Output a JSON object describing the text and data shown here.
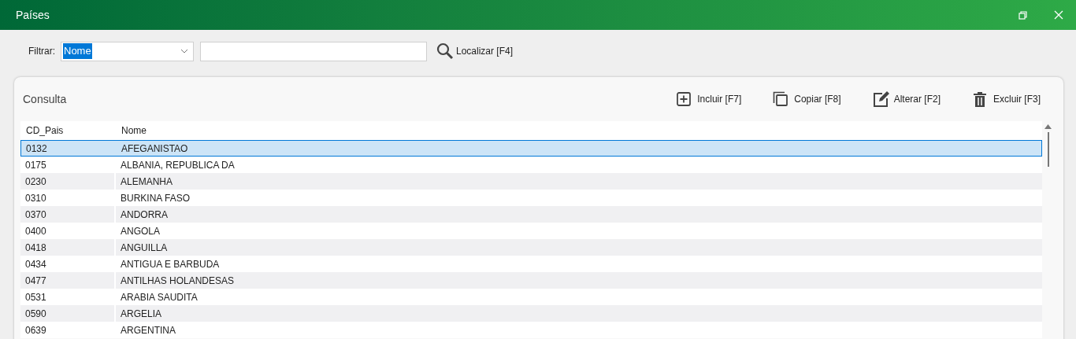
{
  "window": {
    "title": "Países"
  },
  "filter": {
    "label": "Filtrar:",
    "field": "Nome",
    "search_button": "Localizar [F4]"
  },
  "panel": {
    "title": "Consulta",
    "actions": [
      {
        "kind": "add",
        "label": "Incluir [F7]"
      },
      {
        "kind": "copy",
        "label": "Copiar [F8]"
      },
      {
        "kind": "edit",
        "label": "Alterar [F2]"
      },
      {
        "kind": "delete",
        "label": "Excluir [F3]"
      }
    ]
  },
  "table": {
    "columns": [
      "CD_Pais",
      "Nome"
    ],
    "rows": [
      {
        "cells": [
          "0132",
          "AFEGANISTAO"
        ],
        "selected": true
      },
      {
        "cells": [
          "0175",
          "ALBANIA, REPUBLICA DA"
        ],
        "selected": false
      },
      {
        "cells": [
          "0230",
          "ALEMANHA"
        ],
        "selected": false
      },
      {
        "cells": [
          "0310",
          "BURKINA FASO"
        ],
        "selected": false
      },
      {
        "cells": [
          "0370",
          "ANDORRA"
        ],
        "selected": false
      },
      {
        "cells": [
          "0400",
          "ANGOLA"
        ],
        "selected": false
      },
      {
        "cells": [
          "0418",
          "ANGUILLA"
        ],
        "selected": false
      },
      {
        "cells": [
          "0434",
          "ANTIGUA E BARBUDA"
        ],
        "selected": false
      },
      {
        "cells": [
          "0477",
          "ANTILHAS HOLANDESAS"
        ],
        "selected": false
      },
      {
        "cells": [
          "0531",
          "ARABIA SAUDITA"
        ],
        "selected": false
      },
      {
        "cells": [
          "0590",
          "ARGELIA"
        ],
        "selected": false
      },
      {
        "cells": [
          "0639",
          "ARGENTINA"
        ],
        "selected": false
      }
    ]
  }
}
